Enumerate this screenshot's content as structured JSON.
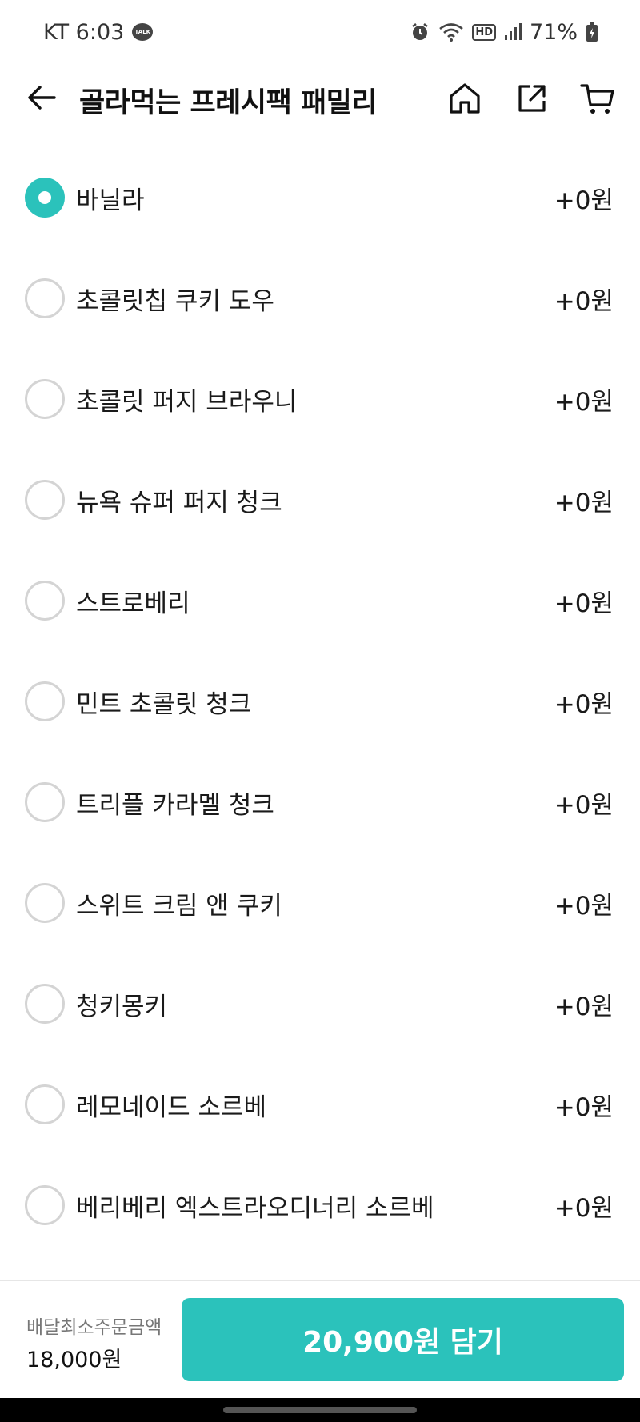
{
  "status_bar": {
    "carrier_time": "KT 6:03",
    "talk_badge": "TALK",
    "battery": "71%",
    "hd_badge": "HD",
    "icons": [
      "talk-icon",
      "alarm-icon",
      "wifi-icon",
      "hd-icon",
      "signal-icon",
      "battery-icon"
    ]
  },
  "header": {
    "title": "골라먹는 프레시팩 패밀리",
    "icons": [
      "back-arrow-icon",
      "home-icon",
      "share-icon",
      "cart-icon"
    ]
  },
  "options": [
    {
      "label": "바닐라",
      "price": "+0원",
      "selected": true
    },
    {
      "label": "초콜릿칩 쿠키 도우",
      "price": "+0원",
      "selected": false
    },
    {
      "label": "초콜릿 퍼지 브라우니",
      "price": "+0원",
      "selected": false
    },
    {
      "label": "뉴욕 슈퍼 퍼지 청크",
      "price": "+0원",
      "selected": false
    },
    {
      "label": "스트로베리",
      "price": "+0원",
      "selected": false
    },
    {
      "label": "민트 초콜릿 청크",
      "price": "+0원",
      "selected": false
    },
    {
      "label": "트리플 카라멜 청크",
      "price": "+0원",
      "selected": false
    },
    {
      "label": "스위트 크림 앤 쿠키",
      "price": "+0원",
      "selected": false
    },
    {
      "label": "청키몽키",
      "price": "+0원",
      "selected": false
    },
    {
      "label": "레모네이드 소르베",
      "price": "+0원",
      "selected": false
    },
    {
      "label": "베리베리 엑스트라오디너리 소르베",
      "price": "+0원",
      "selected": false
    }
  ],
  "footer": {
    "min_order_label": "배달최소주문금액",
    "min_order_value": "18,000원",
    "add_button_label": "20,900원 담기"
  },
  "colors": {
    "accent": "#2bc2bb",
    "radio_border": "#d4d4d4"
  }
}
